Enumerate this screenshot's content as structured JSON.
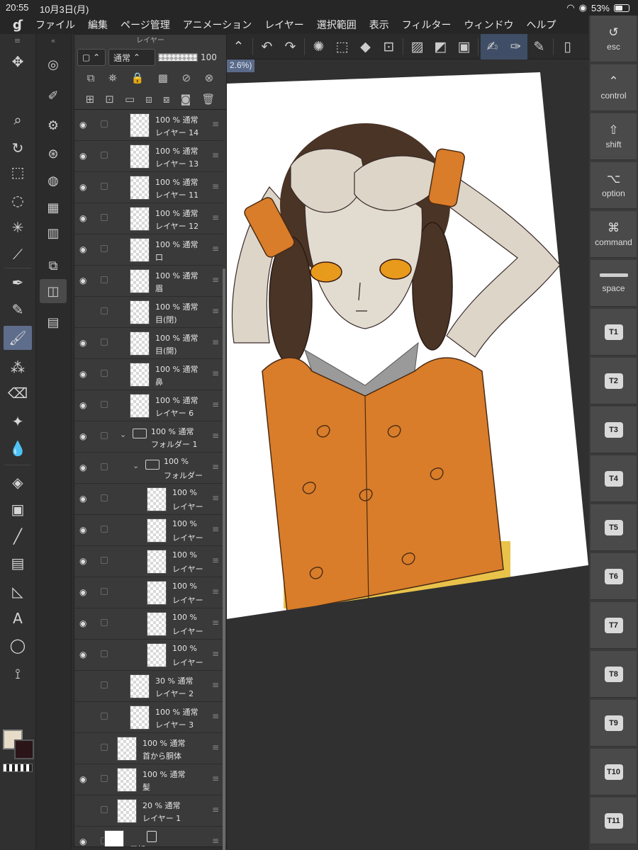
{
  "status": {
    "time": "20:55",
    "date": "10月3日(月)",
    "battery": "53%",
    "battery_level": 0.53
  },
  "menu": {
    "items": [
      "ファイル",
      "編集",
      "ページ管理",
      "アニメーション",
      "レイヤー",
      "選択範囲",
      "表示",
      "フィルター",
      "ウィンドウ",
      "ヘルプ"
    ]
  },
  "zoom": "2.6%)",
  "layer_panel": {
    "title": "レイヤー",
    "blend_mode": "通常",
    "opacity": "100"
  },
  "layers": [
    {
      "opacity": "100 %",
      "mode": "通常",
      "name": "レイヤー 14",
      "visible": true
    },
    {
      "opacity": "100 %",
      "mode": "通常",
      "name": "レイヤー 13",
      "visible": true
    },
    {
      "opacity": "100 %",
      "mode": "通常",
      "name": "レイヤー 11",
      "visible": true
    },
    {
      "opacity": "100 %",
      "mode": "通常",
      "name": "レイヤー 12",
      "visible": true
    },
    {
      "opacity": "100 %",
      "mode": "通常",
      "name": "口",
      "visible": true
    },
    {
      "opacity": "100 %",
      "mode": "通常",
      "name": "眉",
      "visible": true
    },
    {
      "opacity": "100 %",
      "mode": "通常",
      "name": "目(閉)",
      "visible": false
    },
    {
      "opacity": "100 %",
      "mode": "通常",
      "name": "目(開)",
      "visible": true
    },
    {
      "opacity": "100 %",
      "mode": "通常",
      "name": "鼻",
      "visible": true
    },
    {
      "opacity": "100 %",
      "mode": "通常",
      "name": "レイヤー 6",
      "visible": true
    },
    {
      "opacity": "100 %",
      "mode": "通常",
      "name": "フォルダー 1",
      "visible": true,
      "folder": true
    },
    {
      "opacity": "100 %",
      "mode": "",
      "name": "フォルダー",
      "visible": true,
      "folder": true
    },
    {
      "opacity": "100 %",
      "mode": "",
      "name": "レイヤー",
      "visible": true
    },
    {
      "opacity": "100 %",
      "mode": "",
      "name": "レイヤー",
      "visible": true
    },
    {
      "opacity": "100 %",
      "mode": "",
      "name": "レイヤー",
      "visible": true
    },
    {
      "opacity": "100 %",
      "mode": "",
      "name": "レイヤー",
      "visible": true
    },
    {
      "opacity": "100 %",
      "mode": "",
      "name": "レイヤー",
      "visible": true
    },
    {
      "opacity": "100 %",
      "mode": "",
      "name": "レイヤー",
      "visible": true
    },
    {
      "opacity": "30 %",
      "mode": "通常",
      "name": "レイヤー 2",
      "visible": false
    },
    {
      "opacity": "100 %",
      "mode": "通常",
      "name": "レイヤー 3",
      "visible": false
    },
    {
      "opacity": "100 %",
      "mode": "通常",
      "name": "首から胴体",
      "visible": false
    },
    {
      "opacity": "100 %",
      "mode": "通常",
      "name": "髪",
      "visible": true
    },
    {
      "opacity": "20 %",
      "mode": "通常",
      "name": "レイヤー 1",
      "visible": false
    },
    {
      "opacity": "",
      "mode": "",
      "name": "用紙",
      "visible": true
    }
  ],
  "shortcuts": [
    {
      "glyph": "↺",
      "label": "esc"
    },
    {
      "glyph": "⌃",
      "label": "control"
    },
    {
      "glyph": "⇧",
      "label": "shift"
    },
    {
      "glyph": "⌥",
      "label": "option"
    },
    {
      "glyph": "⌘",
      "label": "command"
    },
    {
      "glyph": "",
      "label": "space"
    }
  ],
  "t_keys": [
    "T1",
    "T2",
    "T3",
    "T4",
    "T5",
    "T6",
    "T7",
    "T8",
    "T9",
    "T10",
    "T11"
  ],
  "colors": {
    "main": "#e7dcc8",
    "sub": "#2b1518",
    "vest": "#d97d2a",
    "hair": "#4a3426",
    "skin": "#ddd6c8"
  }
}
